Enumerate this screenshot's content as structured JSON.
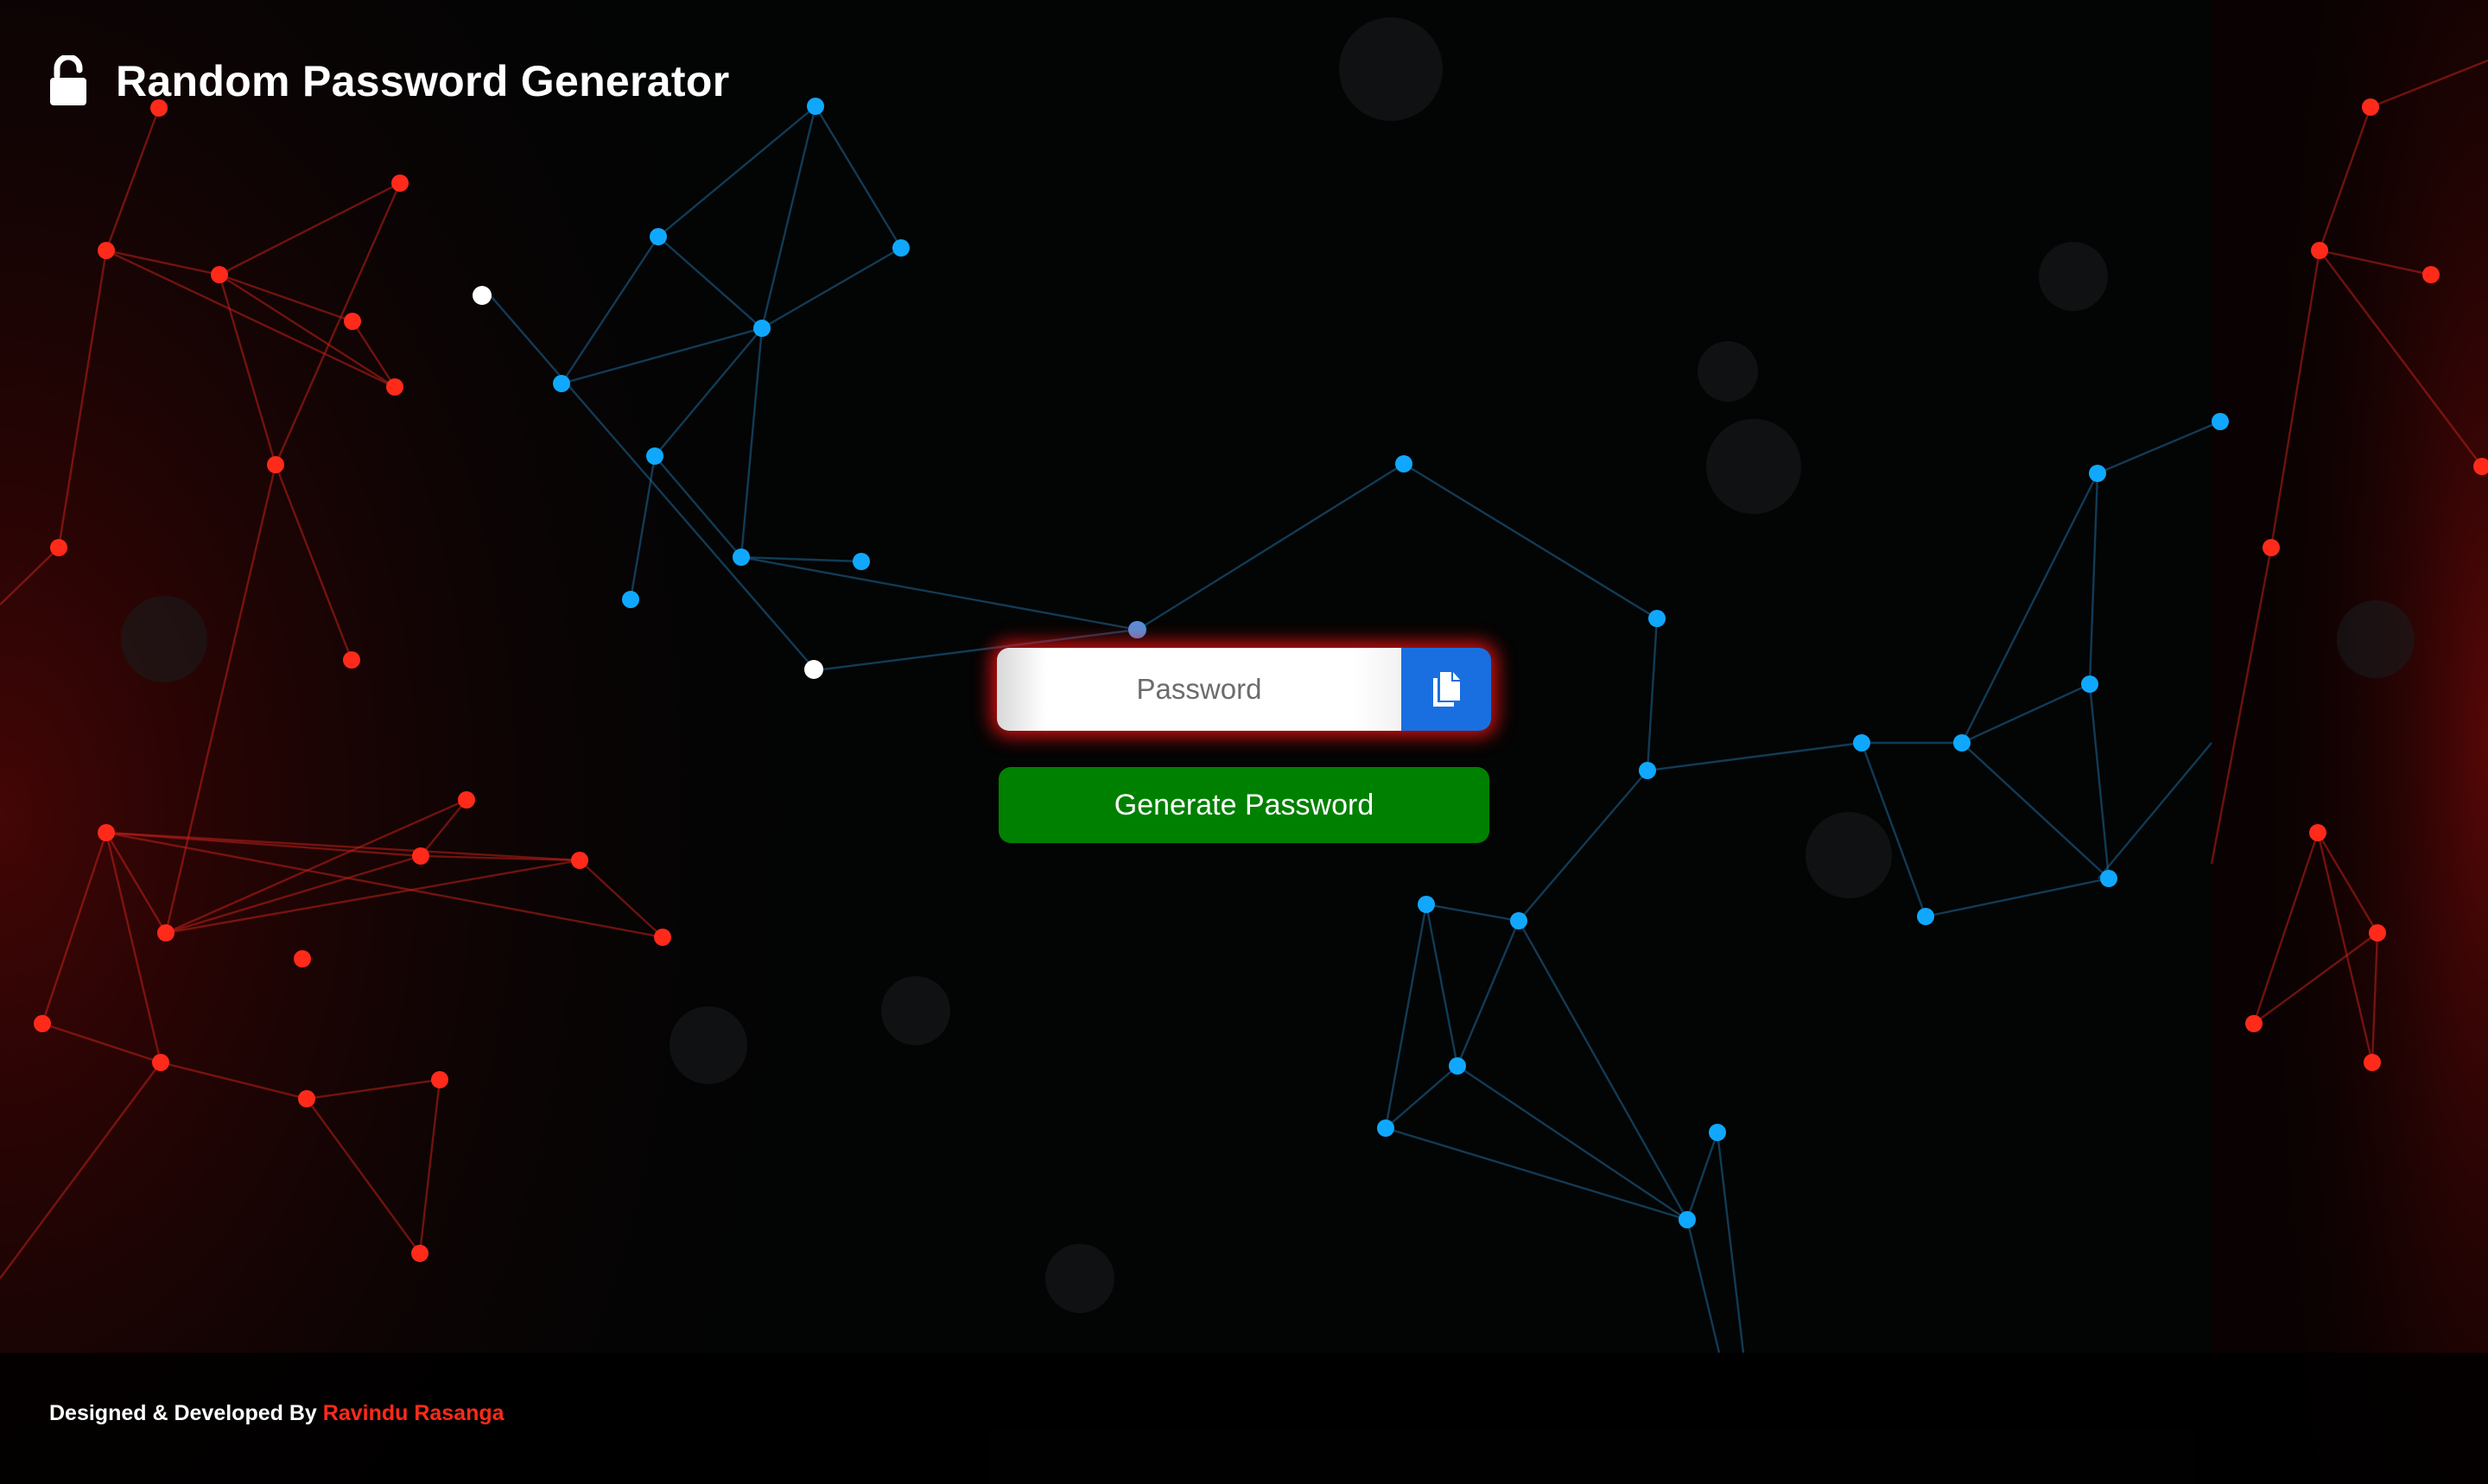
{
  "header": {
    "title": "Random Password Generator",
    "icon": "lock-open-icon"
  },
  "password_field": {
    "placeholder": "Password",
    "value": ""
  },
  "copy_button": {
    "icon": "copy-icon",
    "color": "#1a6fe0"
  },
  "generate_button": {
    "label": "Generate Password",
    "color": "#008000"
  },
  "footer": {
    "credit_prefix": "Designed & Developed By",
    "author": "Ravindu Rasanga",
    "author_color": "#ff2a1a"
  },
  "theme": {
    "accent_red": "#ff2a1a",
    "accent_blue": "#10a8ff",
    "glow": "#ff1414",
    "background": "#020303"
  }
}
